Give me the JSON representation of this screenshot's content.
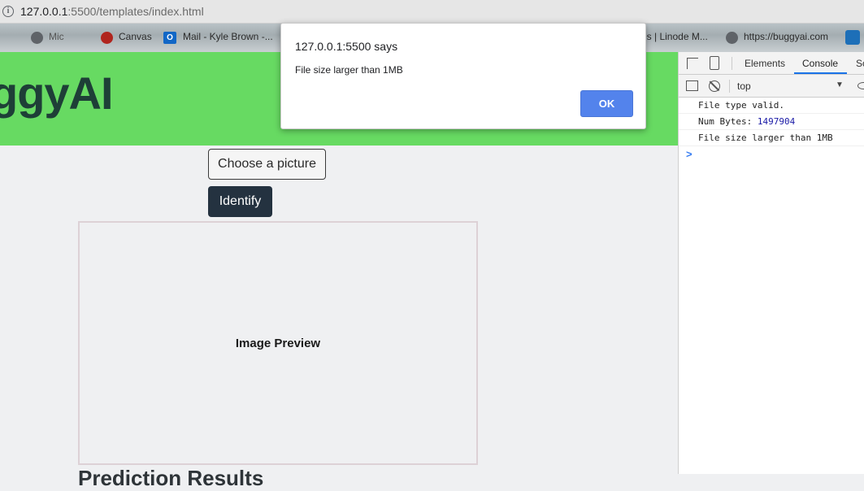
{
  "browser": {
    "url_host": "127.0.0.1",
    "url_port_path": ":5500/templates/index.html",
    "info_icon": "i",
    "bookmarks": [
      {
        "label": "Mic",
        "icon": "globe-icon"
      },
      {
        "label": "Canvas",
        "icon": "canvas-icon"
      },
      {
        "label": "Mail - Kyle Brown -...",
        "icon": "outlook-icon"
      },
      {
        "label": "es | Linode M...",
        "icon": "none"
      },
      {
        "label": "https://buggyai.com",
        "icon": "globe-icon"
      }
    ],
    "outlook_glyph": "O"
  },
  "page": {
    "title": "BuggyAI",
    "title_visible": "ggyAI",
    "header_color": "#67da62",
    "choose_button": "Choose a picture",
    "identify_button": "Identify",
    "preview_label": "Image Preview",
    "results_heading": "Prediction Results"
  },
  "devtools": {
    "tabs": [
      "Elements",
      "Console",
      "Sc"
    ],
    "active_tab": "Console",
    "context": "top",
    "context_arrow": "▼",
    "logs": [
      {
        "text": "File type valid."
      },
      {
        "text": "Num Bytes: ",
        "value": "1497904"
      },
      {
        "text": "File size larger than 1MB"
      }
    ],
    "prompt_symbol": ">"
  },
  "dialog": {
    "title": "127.0.0.1:5500 says",
    "message": "File size larger than 1MB",
    "ok_label": "OK",
    "ok_color": "#5383ec"
  }
}
